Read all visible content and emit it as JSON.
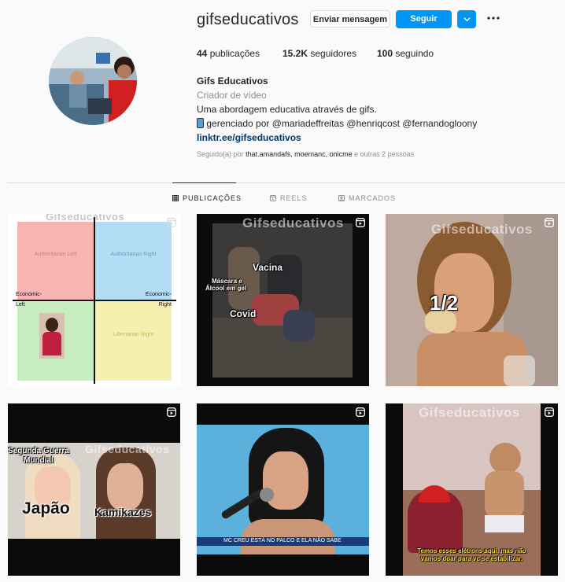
{
  "profile": {
    "username": "gifseducativos",
    "message_button": "Enviar mensagem",
    "follow_button": "Seguir",
    "stats": {
      "posts_count": "44",
      "posts_label": "publicações",
      "followers_count": "15.2K",
      "followers_label": "seguidores",
      "following_count": "100",
      "following_label": "seguindo"
    },
    "bio": {
      "name": "Gifs Educativos",
      "category": "Criador de vídeo",
      "line1": "Uma abordagem educativa através de gifs.",
      "line2_prefix": "gerenciado por",
      "mentions": "@mariadeffreitas @henriqcost @fernandogloony",
      "link": "linktr.ee/gifseducativos"
    },
    "followed_by": {
      "prefix": "Seguido(a) por",
      "names": "that.amandafs, moemanc, onicme",
      "suffix": "e outras 2 pessoas"
    }
  },
  "tabs": [
    {
      "label": "PUBLICAÇÕES",
      "icon": "grid-icon",
      "active": true
    },
    {
      "label": "REELS",
      "icon": "reels-icon",
      "active": false
    },
    {
      "label": "MARCADOS",
      "icon": "tagged-icon",
      "active": false
    }
  ],
  "posts": {
    "p1": {
      "watermark": "Gifseducativos",
      "q_tl": "Authoritarian Left",
      "q_tr": "Authoritarian Right",
      "q_bl": "",
      "q_br": "Libertarian Right",
      "econ_left": "Economic-Left",
      "econ_right": "Economic-Right",
      "colors": {
        "tl": "#f8b3b3",
        "tr": "#b3dcf5",
        "bl": "#c6ecc0",
        "br": "#f5f0b0"
      }
    },
    "p2": {
      "watermark": "Gifseducativos",
      "cap1": "Vacina",
      "cap2a": "Máscara e",
      "cap2b": "Álcool em gel",
      "cap3": "Covid"
    },
    "p3": {
      "watermark": "Gifseducativos",
      "cap": "1/2"
    },
    "p4": {
      "watermark": "Gifseducativos",
      "cap1a": "Segunda Guerra",
      "cap1b": "Mundial",
      "cap2": "Japão",
      "cap3": "Kamikazes"
    },
    "p5": {
      "ticker": "MC CREU ESTÁ NO PALCO E ELA NÃO SABE"
    },
    "p6": {
      "watermark": "Gifseducativos",
      "sub1": "Temos esses elétrons aqui, mas não",
      "sub2": "vamos doar para vc se estabilizar."
    }
  }
}
